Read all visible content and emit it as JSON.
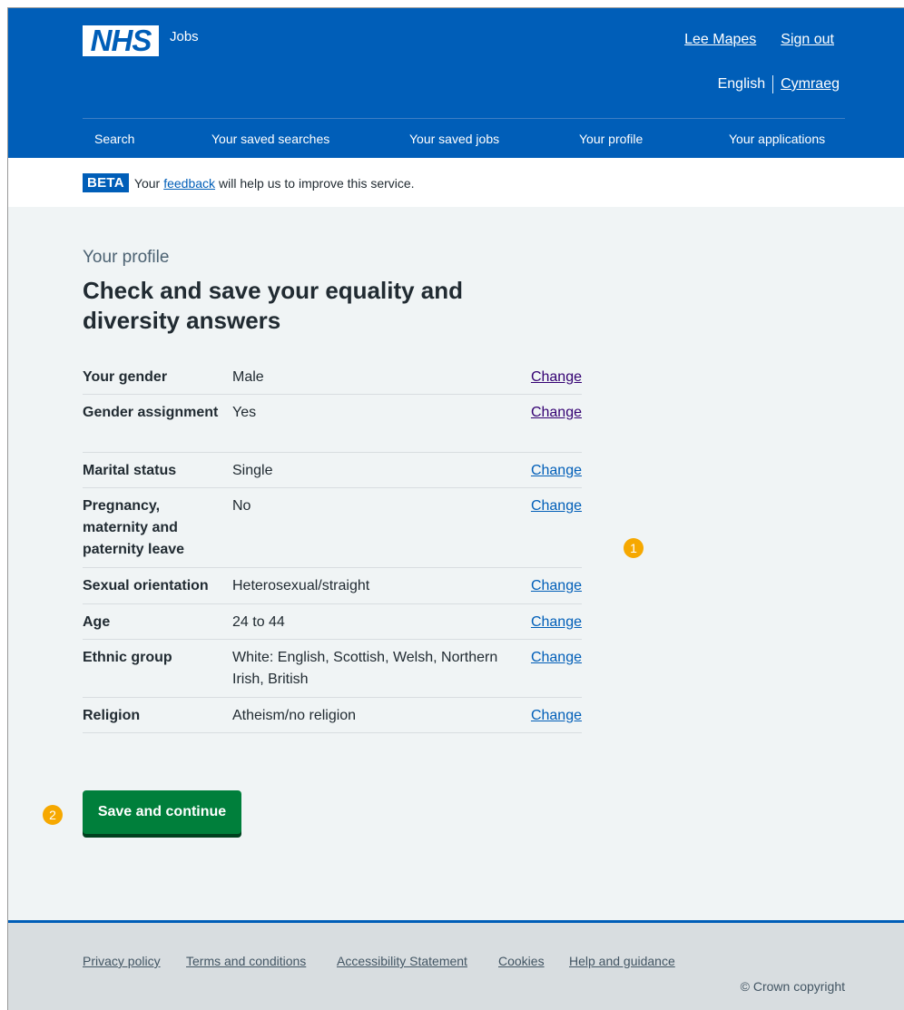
{
  "header": {
    "logo_text": "NHS",
    "service_name": "Jobs",
    "account": {
      "user": "Lee Mapes",
      "sign_out": "Sign out"
    },
    "language": {
      "current": "English",
      "alternate": "Cymraeg"
    },
    "nav": [
      "Search",
      "Your saved searches",
      "Your saved jobs",
      "Your profile",
      "Your applications"
    ]
  },
  "beta_banner": {
    "tag": "BETA",
    "text_before": "Your",
    "link": "feedback",
    "text_after": "will help us to improve this service."
  },
  "main": {
    "caption": "Your profile",
    "title": "Check and save your equality and diversity answers",
    "rows": [
      {
        "key": "Your gender",
        "value": "Male",
        "action": "Change"
      },
      {
        "key": "Gender assignment",
        "value": "Yes",
        "action": "Change"
      },
      {
        "key": "Marital status",
        "value": "Single",
        "action": "Change"
      },
      {
        "key": "Pregnancy, maternity and paternity leave",
        "value": "No",
        "action": "Change"
      },
      {
        "key": "Sexual orientation",
        "value": "Heterosexual/straight",
        "action": "Change"
      },
      {
        "key": "Age",
        "value": "24 to 44",
        "action": "Change"
      },
      {
        "key": "Ethnic group",
        "value": "White: English, Scottish, Welsh, Northern Irish, British",
        "action": "Change"
      },
      {
        "key": "Religion",
        "value": "Atheism/no religion",
        "action": "Change"
      }
    ],
    "save_button": "Save and continue"
  },
  "markers": {
    "one": "1",
    "two": "2"
  },
  "footer": {
    "links": [
      "Privacy policy",
      "Terms and conditions",
      "Accessibility Statement",
      "Cookies",
      "Help and guidance"
    ],
    "copyright": "© Crown copyright"
  },
  "colors": {
    "nhs_blue": "#005eb8",
    "button_green": "#007f3b",
    "badge_orange": "#f6a800",
    "visited_link": "#330072"
  }
}
